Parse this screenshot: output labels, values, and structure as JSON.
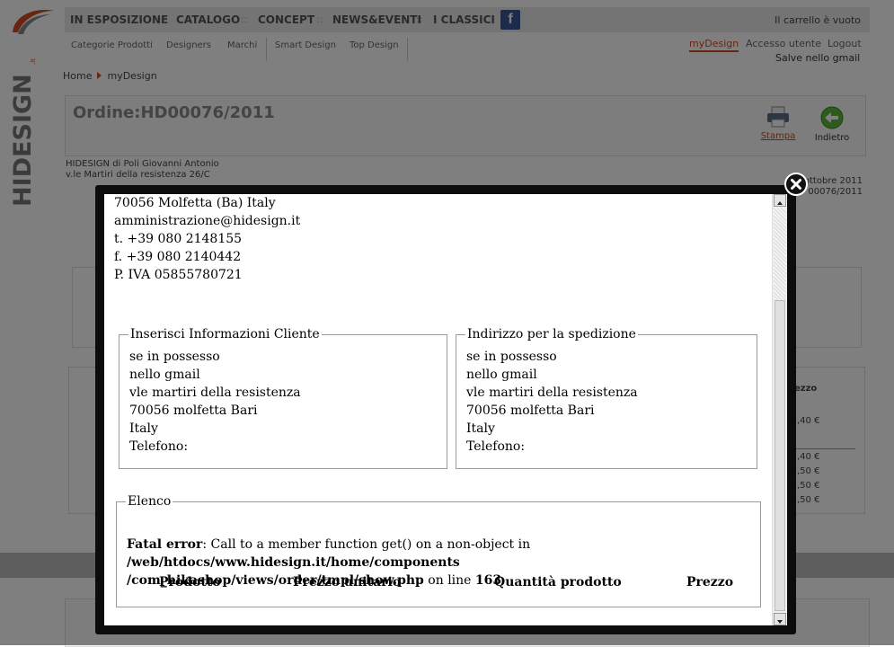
{
  "nav": {
    "items": [
      "IN ESPOSIZIONE",
      "CATALOGO",
      "CONCEPT",
      "NEWS&EVENTI",
      "I CLASSICI"
    ],
    "cart": "Il carrello è vuoto"
  },
  "subnav": {
    "items": [
      "Categorie Prodotti",
      "Designers",
      "Marchi",
      "Smart Design",
      "Top Design"
    ],
    "user_links": [
      "myDesign",
      "Accesso utente",
      "Logout"
    ],
    "greeting": "Salve nello gmail"
  },
  "breadcrumb": [
    "Home",
    "myDesign"
  ],
  "order": {
    "title": "Ordine:HD00076/2011",
    "print_label": "Stampa",
    "back_label": "Indietro"
  },
  "background": {
    "company_lines": [
      "HIDESIGN di Poli Giovanni Antonio",
      "v.le Martiri della resistenza 26/C"
    ],
    "date_fragment": "ottobre 2011",
    "order_fragment": "00076/2011",
    "prices": [
      ",40 €",
      ",40 €",
      ",50 €",
      ",50 €",
      ",50 €"
    ],
    "price_header": "ezzo"
  },
  "modal": {
    "contact_lines": [
      "70056 Molfetta (Ba) Italy",
      "amministrazione@hidesign.it",
      "t. +39 080 2148155",
      "f. +39 080 2140442",
      "P. IVA 05855780721"
    ],
    "customer": {
      "legend": "Inserisci Informazioni Cliente",
      "lines": [
        "se in possesso",
        "nello gmail",
        "vle martiri della resistenza",
        "70056 molfetta Bari",
        "Italy",
        "Telefono:"
      ]
    },
    "shipping": {
      "legend": "Indirizzo per la spedizione",
      "lines": [
        "se in possesso",
        "nello gmail",
        "vle martiri della resistenza",
        "70056 molfetta Bari",
        "Italy",
        "Telefono:"
      ]
    },
    "list": {
      "legend": "Elenco",
      "error_label": "Fatal error",
      "error_text": ": Call to a member function get() on a non-object in ",
      "error_path": "/web/htdocs/www.hidesign.it/home/components /com_hikashop/views/order/tmpl/show.php",
      "error_online": " on line ",
      "error_line": "163",
      "columns": [
        "Prodotto",
        "Prezzo unitario",
        "Quantità prodotto",
        "Prezzo"
      ]
    }
  },
  "colors": {
    "accent": "#d04a1e",
    "modal_border": "#0c0c0c",
    "facebook": "#3b5998"
  }
}
